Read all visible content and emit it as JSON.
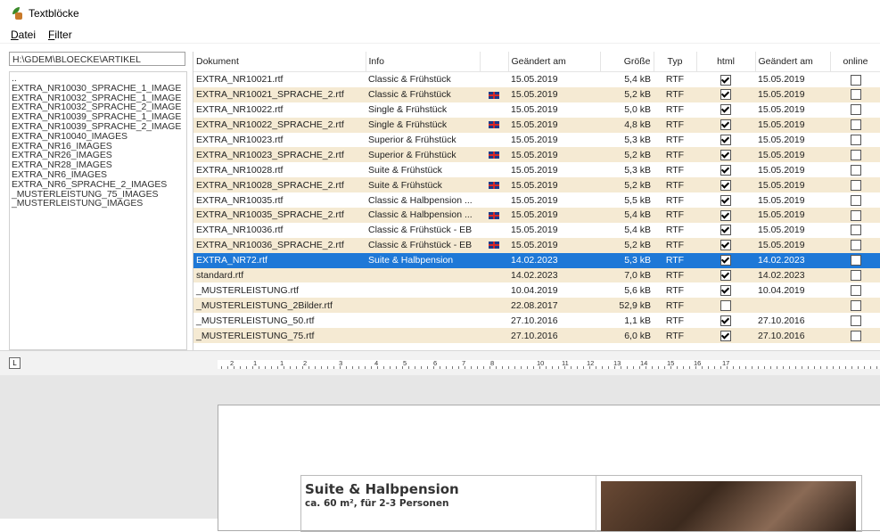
{
  "window": {
    "title": "Textblöcke"
  },
  "menu": [
    {
      "label": "Datei",
      "u": "D",
      "rest": "atei"
    },
    {
      "label": "Filter",
      "u": "F",
      "rest": "ilter"
    }
  ],
  "left": {
    "path": "H:\\GDEM\\BLOECKE\\ARTIKEL",
    "folders": [
      "..",
      "EXTRA_NR10030_SPRACHE_1_IMAGE",
      "EXTRA_NR10032_SPRACHE_1_IMAGE",
      "EXTRA_NR10032_SPRACHE_2_IMAGE",
      "EXTRA_NR10039_SPRACHE_1_IMAGE",
      "EXTRA_NR10039_SPRACHE_2_IMAGE",
      "EXTRA_NR10040_IMAGES",
      "EXTRA_NR16_IMAGES",
      "EXTRA_NR26_IMAGES",
      "EXTRA_NR28_IMAGES",
      "EXTRA_NR6_IMAGES",
      "EXTRA_NR6_SPRACHE_2_IMAGES",
      "_MUSTERLEISTUNG_75_IMAGES",
      "_MUSTERLEISTUNG_IMAGES"
    ]
  },
  "table": {
    "headers": [
      "Dokument",
      "Info",
      "",
      "Geändert am",
      "Größe",
      "Typ",
      "html",
      "Geändert am",
      "online"
    ],
    "rows": [
      {
        "doc": "EXTRA_NR10021.rtf",
        "info": "Classic & Frühstück",
        "flag": false,
        "date": "15.05.2019",
        "size": "5,4 kB",
        "type": "RTF",
        "html": true,
        "date2": "15.05.2019",
        "online": false
      },
      {
        "doc": "EXTRA_NR10021_SPRACHE_2.rtf",
        "info": "Classic & Frühstück",
        "flag": true,
        "date": "15.05.2019",
        "size": "5,2 kB",
        "type": "RTF",
        "html": true,
        "date2": "15.05.2019",
        "online": false
      },
      {
        "doc": "EXTRA_NR10022.rtf",
        "info": "Single & Frühstück",
        "flag": false,
        "date": "15.05.2019",
        "size": "5,0 kB",
        "type": "RTF",
        "html": true,
        "date2": "15.05.2019",
        "online": false
      },
      {
        "doc": "EXTRA_NR10022_SPRACHE_2.rtf",
        "info": "Single & Frühstück",
        "flag": true,
        "date": "15.05.2019",
        "size": "4,8 kB",
        "type": "RTF",
        "html": true,
        "date2": "15.05.2019",
        "online": false
      },
      {
        "doc": "EXTRA_NR10023.rtf",
        "info": "Superior & Frühstück",
        "flag": false,
        "date": "15.05.2019",
        "size": "5,3 kB",
        "type": "RTF",
        "html": true,
        "date2": "15.05.2019",
        "online": false
      },
      {
        "doc": "EXTRA_NR10023_SPRACHE_2.rtf",
        "info": "Superior & Frühstück",
        "flag": true,
        "date": "15.05.2019",
        "size": "5,2 kB",
        "type": "RTF",
        "html": true,
        "date2": "15.05.2019",
        "online": false
      },
      {
        "doc": "EXTRA_NR10028.rtf",
        "info": "Suite & Frühstück",
        "flag": false,
        "date": "15.05.2019",
        "size": "5,3 kB",
        "type": "RTF",
        "html": true,
        "date2": "15.05.2019",
        "online": false
      },
      {
        "doc": "EXTRA_NR10028_SPRACHE_2.rtf",
        "info": "Suite & Frühstück",
        "flag": true,
        "date": "15.05.2019",
        "size": "5,2 kB",
        "type": "RTF",
        "html": true,
        "date2": "15.05.2019",
        "online": false
      },
      {
        "doc": "EXTRA_NR10035.rtf",
        "info": "Classic & Halbpension ...",
        "flag": false,
        "date": "15.05.2019",
        "size": "5,5 kB",
        "type": "RTF",
        "html": true,
        "date2": "15.05.2019",
        "online": false
      },
      {
        "doc": "EXTRA_NR10035_SPRACHE_2.rtf",
        "info": "Classic & Halbpension ...",
        "flag": true,
        "date": "15.05.2019",
        "size": "5,4 kB",
        "type": "RTF",
        "html": true,
        "date2": "15.05.2019",
        "online": false
      },
      {
        "doc": "EXTRA_NR10036.rtf",
        "info": "Classic & Frühstück - EB",
        "flag": false,
        "date": "15.05.2019",
        "size": "5,4 kB",
        "type": "RTF",
        "html": true,
        "date2": "15.05.2019",
        "online": false
      },
      {
        "doc": "EXTRA_NR10036_SPRACHE_2.rtf",
        "info": "Classic & Frühstück - EB",
        "flag": true,
        "date": "15.05.2019",
        "size": "5,2 kB",
        "type": "RTF",
        "html": true,
        "date2": "15.05.2019",
        "online": false
      },
      {
        "doc": "EXTRA_NR72.rtf",
        "info": "Suite & Halbpension",
        "flag": false,
        "date": "14.02.2023",
        "size": "5,3 kB",
        "type": "RTF",
        "html": true,
        "date2": "14.02.2023",
        "online": false,
        "selected": true
      },
      {
        "doc": "standard.rtf",
        "info": "",
        "flag": false,
        "date": "14.02.2023",
        "size": "7,0 kB",
        "type": "RTF",
        "html": true,
        "date2": "14.02.2023",
        "online": false
      },
      {
        "doc": "_MUSTERLEISTUNG.rtf",
        "info": "",
        "flag": false,
        "date": "10.04.2019",
        "size": "5,6 kB",
        "type": "RTF",
        "html": true,
        "date2": "10.04.2019",
        "online": false
      },
      {
        "doc": "_MUSTERLEISTUNG_2Bilder.rtf",
        "info": "",
        "flag": false,
        "date": "22.08.2017",
        "size": "52,9 kB",
        "type": "RTF",
        "html": false,
        "date2": "",
        "online": false
      },
      {
        "doc": "_MUSTERLEISTUNG_50.rtf",
        "info": "",
        "flag": false,
        "date": "27.10.2016",
        "size": "1,1 kB",
        "type": "RTF",
        "html": true,
        "date2": "27.10.2016",
        "online": false
      },
      {
        "doc": "_MUSTERLEISTUNG_75.rtf",
        "info": "",
        "flag": false,
        "date": "27.10.2016",
        "size": "6,0 kB",
        "type": "RTF",
        "html": true,
        "date2": "27.10.2016",
        "online": false
      }
    ]
  },
  "ruler": {
    "corner": "L",
    "numbers": [
      "2",
      "1",
      "1",
      "2",
      "3",
      "4",
      "5",
      "6",
      "7",
      "8",
      "10",
      "11",
      "12",
      "13",
      "14",
      "15",
      "16",
      "17"
    ]
  },
  "preview": {
    "title": "Suite & Halbpension",
    "subtitle": "ca. 60 m², für 2-3 Personen"
  }
}
